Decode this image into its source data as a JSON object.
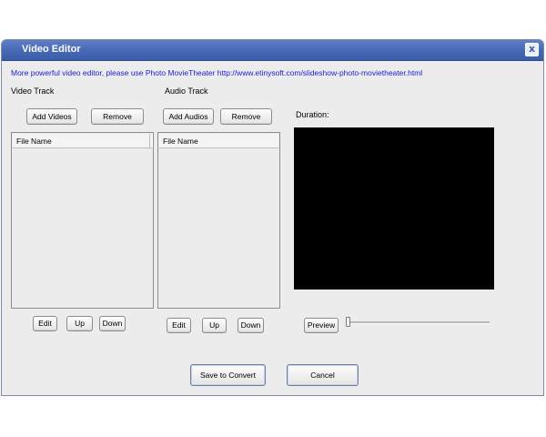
{
  "window": {
    "title": "Video Editor",
    "close_glyph": "x"
  },
  "promo_text": "More powerful video editor, please use Photo MovieTheater  http://www.etinysoft.com/slideshow-photo-movietheater.html",
  "video_track": {
    "label": "Video Track",
    "add_label": "Add Videos",
    "remove_label": "Remove",
    "column_header": "File Name",
    "items": [],
    "edit_label": "Edit",
    "up_label": "Up",
    "down_label": "Down"
  },
  "audio_track": {
    "label": "Audio Track",
    "add_label": "Add Audios",
    "remove_label": "Remove",
    "column_header": "File Name",
    "items": [],
    "edit_label": "Edit",
    "up_label": "Up",
    "down_label": "Down"
  },
  "preview": {
    "duration_label": "Duration:",
    "preview_label": "Preview",
    "position": 0
  },
  "footer": {
    "save_label": "Save to Convert",
    "cancel_label": "Cancel"
  },
  "colors": {
    "titlebar": "#4a6cb8",
    "link": "#1a1ad6",
    "screen": "#000000"
  },
  "icons": {
    "close": "close-icon"
  }
}
